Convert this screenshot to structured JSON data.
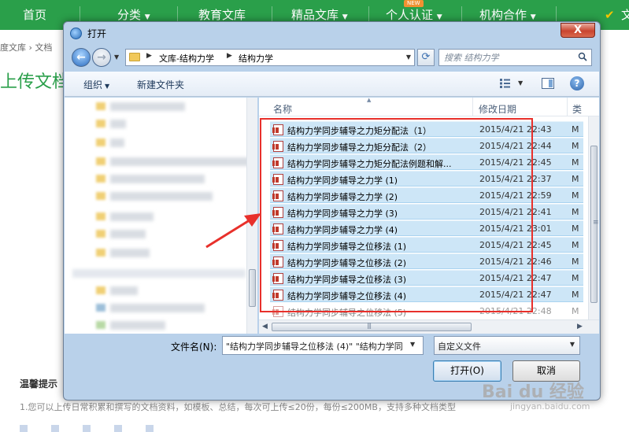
{
  "site": {
    "nav": [
      "首页",
      "分类",
      "教育文库",
      "精品文库",
      "个人认证",
      "机构合作",
      "文"
    ],
    "new_badge": "NEW",
    "breadcrumb": "度文库 › 文档",
    "upload_title": "上传文档",
    "tips_title": "温馨提示",
    "tips_line": "1.您可以上传日常积累和撰写的文档资料，如模板、总结，每次可上传≤20份，每份≤200MB，支持多种文档类型",
    "watermark": "Bai du 经验",
    "watermark_sub": "jingyan.baidu.com",
    "accent_color": "#2a9f4a"
  },
  "dialog": {
    "title": "打开",
    "close_label": "X",
    "address": [
      "文库-结构力学",
      "结构力学"
    ],
    "search_placeholder": "搜索 结构力学",
    "toolbar": {
      "organize": "组织",
      "new_folder": "新建文件夹"
    },
    "columns": {
      "name": "名称",
      "date": "修改日期",
      "type": "类"
    },
    "files": [
      {
        "name": "结构力学同步辅导之力矩分配法（1）",
        "date": "2015/4/21 22:43",
        "type": "M"
      },
      {
        "name": "结构力学同步辅导之力矩分配法（2）",
        "date": "2015/4/21 22:44",
        "type": "M"
      },
      {
        "name": "结构力学同步辅导之力矩分配法例题和解...",
        "date": "2015/4/21 22:45",
        "type": "M"
      },
      {
        "name": "结构力学同步辅导之力学 (1)",
        "date": "2015/4/21 22:37",
        "type": "M"
      },
      {
        "name": "结构力学同步辅导之力学 (2)",
        "date": "2015/4/21 22:59",
        "type": "M"
      },
      {
        "name": "结构力学同步辅导之力学 (3)",
        "date": "2015/4/21 22:41",
        "type": "M"
      },
      {
        "name": "结构力学同步辅导之力学 (4)",
        "date": "2015/4/21 23:01",
        "type": "M"
      },
      {
        "name": "结构力学同步辅导之位移法 (1)",
        "date": "2015/4/21 22:45",
        "type": "M"
      },
      {
        "name": "结构力学同步辅导之位移法 (2)",
        "date": "2015/4/21 22:46",
        "type": "M"
      },
      {
        "name": "结构力学同步辅导之位移法 (3)",
        "date": "2015/4/21 22:47",
        "type": "M"
      },
      {
        "name": "结构力学同步辅导之位移法 (4)",
        "date": "2015/4/21 22:47",
        "type": "M"
      },
      {
        "name": "结构力学同步辅导之位移法 (5)",
        "date": "2015/4/21 22:48",
        "type": "M"
      }
    ],
    "filename_label": "文件名(N):",
    "filename_value": "\"结构力学同步辅导之位移法 (4)\" \"结构力学同",
    "filter_value": "自定义文件",
    "open_label": "打开(O)",
    "cancel_label": "取消",
    "highlight_color": "#e8302b"
  }
}
